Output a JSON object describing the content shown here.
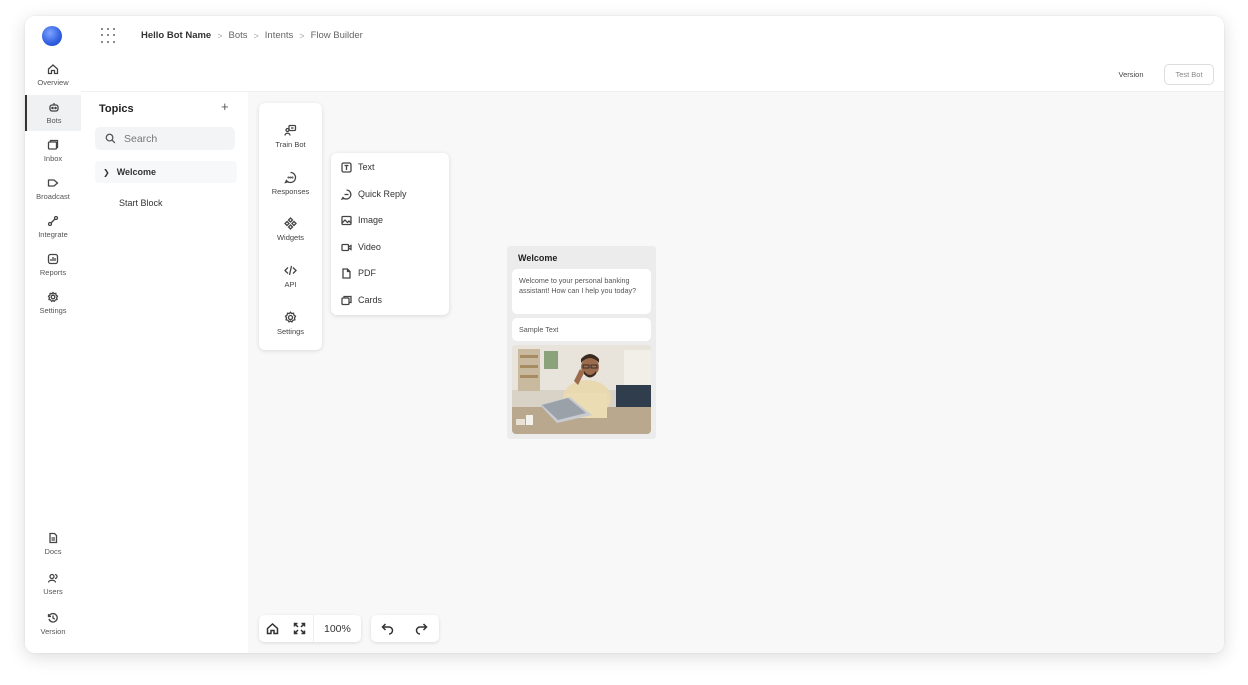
{
  "nav": {
    "items": [
      {
        "label": "Overview",
        "icon": "home-icon"
      },
      {
        "label": "Bots",
        "icon": "bot-icon"
      },
      {
        "label": "Inbox",
        "icon": "inbox-icon"
      },
      {
        "label": "Broadcast",
        "icon": "broadcast-icon"
      },
      {
        "label": "Integrate",
        "icon": "integrate-icon"
      },
      {
        "label": "Reports",
        "icon": "reports-icon"
      },
      {
        "label": "Settings",
        "icon": "gear-icon"
      }
    ],
    "bottom": [
      {
        "label": "Docs",
        "icon": "document-icon"
      },
      {
        "label": "Users",
        "icon": "users-icon"
      },
      {
        "label": "Version",
        "icon": "history-icon"
      }
    ],
    "active": "Bots"
  },
  "breadcrumb": {
    "items": [
      "Hello Bot Name",
      "Bots",
      "Intents",
      "Flow Builder"
    ],
    "separator": ">"
  },
  "header": {
    "version_label": "Version",
    "test_bot_label": "Test Bot"
  },
  "topics": {
    "title": "Topics",
    "add_symbol": "+",
    "search_placeholder": "Search",
    "groups": [
      {
        "label": "Welcome",
        "expanded": true,
        "children": [
          "Start Block"
        ]
      }
    ]
  },
  "toolbox": {
    "items": [
      {
        "label": "Train Bot",
        "icon": "train-bot-icon"
      },
      {
        "label": "Responses",
        "icon": "chat-bubble-icon"
      },
      {
        "label": "Widgets",
        "icon": "widgets-icon"
      },
      {
        "label": "API",
        "icon": "code-icon"
      },
      {
        "label": "Settings",
        "icon": "gear-icon"
      }
    ]
  },
  "responses_menu": {
    "items": [
      {
        "label": "Text",
        "icon": "text-icon"
      },
      {
        "label": "Quick Reply",
        "icon": "quick-reply-icon"
      },
      {
        "label": "Image",
        "icon": "image-icon"
      },
      {
        "label": "Video",
        "icon": "video-icon"
      },
      {
        "label": "PDF",
        "icon": "pdf-icon"
      },
      {
        "label": "Cards",
        "icon": "cards-icon"
      }
    ]
  },
  "welcome_card": {
    "title": "Welcome",
    "message": "Welcome to your personal banking assistant! How can I help you today?",
    "sample": "Sample Text",
    "image_alt": "Man with glasses working on a laptop"
  },
  "zoom": {
    "level": "100%"
  },
  "colors": {
    "brand": "#2f5fe0",
    "canvas_bg": "#f8f8f8",
    "card_bg": "#ececed"
  }
}
